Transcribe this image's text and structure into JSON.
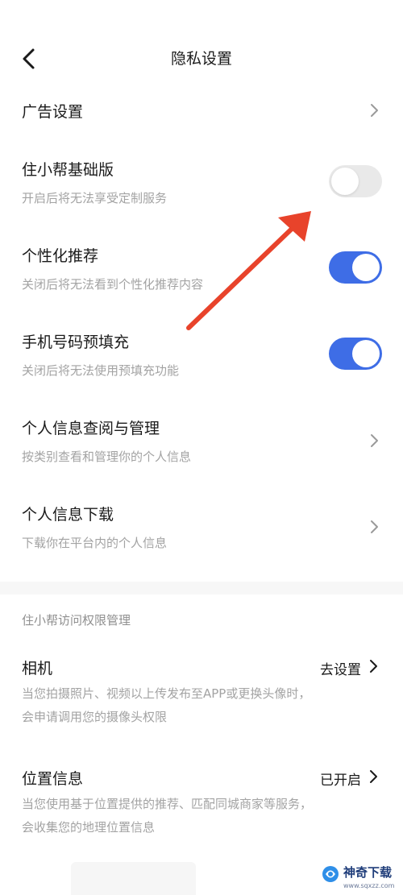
{
  "header": {
    "title": "隐私设置"
  },
  "rows": {
    "ad": {
      "label": "广告设置"
    },
    "basic": {
      "label": "住小帮基础版",
      "desc": "开启后将无法享受定制服务",
      "enabled": false
    },
    "personal": {
      "label": "个性化推荐",
      "desc": "关闭后将无法看到个性化推荐内容",
      "enabled": true
    },
    "phone": {
      "label": "手机号码预填充",
      "desc": "关闭后将无法使用预填充功能",
      "enabled": true
    },
    "info_query": {
      "label": "个人信息查阅与管理",
      "desc": "按类别查看和管理你的个人信息"
    },
    "info_download": {
      "label": "个人信息下载",
      "desc": "下载你在平台内的个人信息"
    }
  },
  "permissions": {
    "section_title": "住小帮访问权限管理",
    "camera": {
      "label": "相机",
      "action": "去设置",
      "desc_line1": "当您拍摄照片、视频以上传发布至APP或更换头像时，",
      "desc_line2": "会申请调用您的摄像头权限"
    },
    "location": {
      "label": "位置信息",
      "action": "已开启",
      "desc_line1": "当您使用基于位置提供的推荐、匹配同城商家等服务，",
      "desc_line2": "会收集您的地理位置信息"
    }
  },
  "annotation": {
    "arrow_color": "#e8432b"
  },
  "watermark": {
    "name": "神奇下载",
    "url": "www.sqxzz.com"
  },
  "colors": {
    "accent": "#3e6de6",
    "toggle_off": "#e9e9e9",
    "desc_text": "#a3a3a3"
  },
  "icons": {
    "back": "chevron-left-icon",
    "row_chevron": "chevron-right-icon"
  }
}
